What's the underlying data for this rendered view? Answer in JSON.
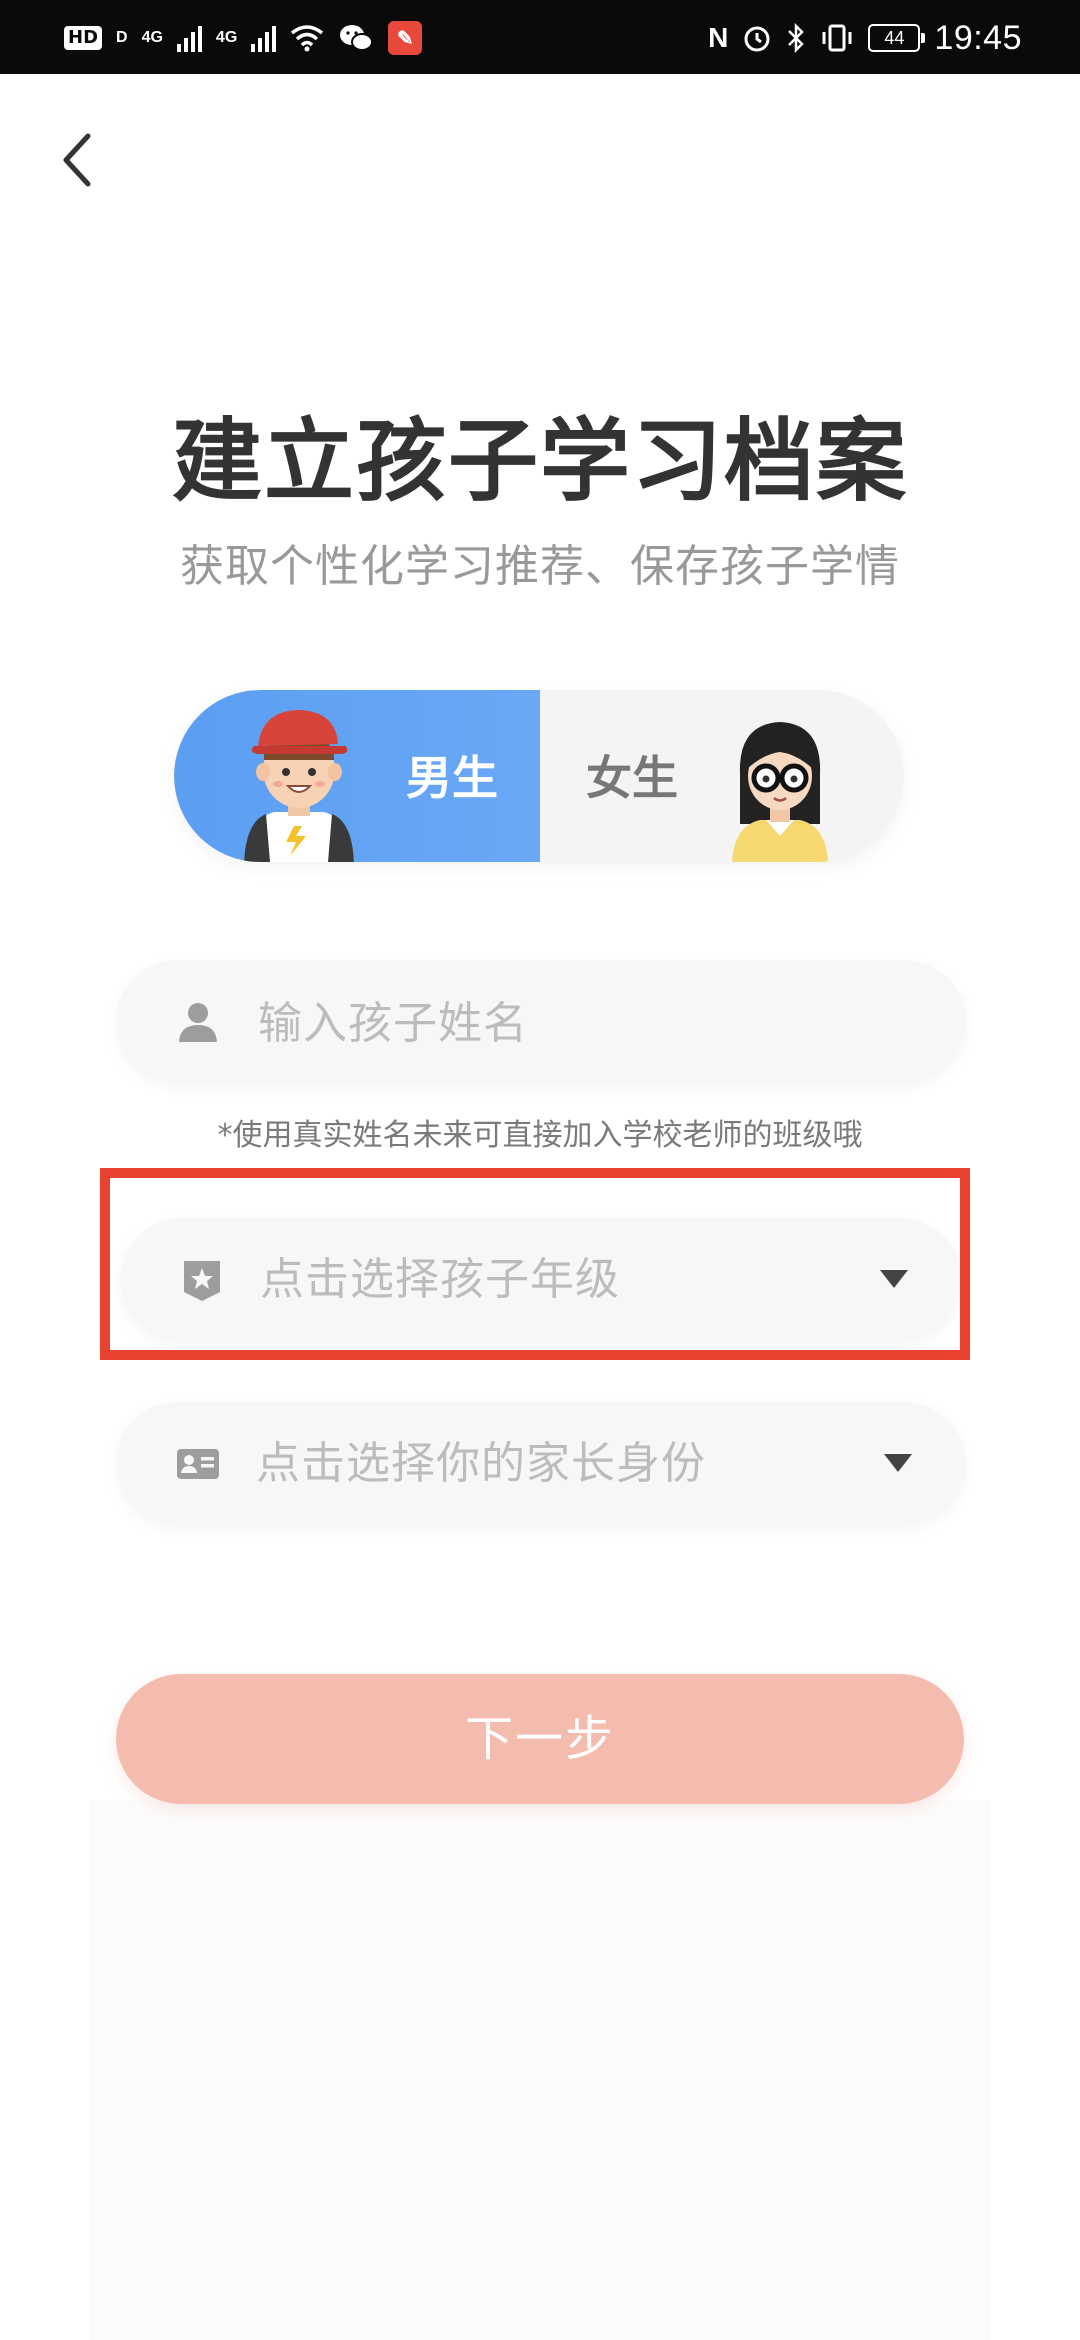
{
  "status_bar": {
    "hd": "HD",
    "hd_sub": "D",
    "signal1": "4G",
    "signal2": "4G",
    "app_icon": "app-notification-icon",
    "nfc": "N",
    "battery": "44",
    "time": "19:45"
  },
  "header": {
    "back_icon": "chevron-left-icon"
  },
  "page": {
    "title": "建立孩子学习档案",
    "subtitle": "获取个性化学习推荐、保存孩子学情"
  },
  "gender": {
    "boy_label": "男生",
    "girl_label": "女生",
    "selected": "男生",
    "active_color": "#5b9ef2"
  },
  "form": {
    "name_placeholder": "输入孩子姓名",
    "name_hint": "*使用真实姓名未来可直接加入学校老师的班级哦",
    "grade_placeholder": "点击选择孩子年级",
    "role_placeholder": "点击选择你的家长身份"
  },
  "actions": {
    "next_label": "下一步",
    "next_color": "#f4bcae"
  },
  "highlight": {
    "target": "grade-select",
    "color": "#e8432e"
  }
}
